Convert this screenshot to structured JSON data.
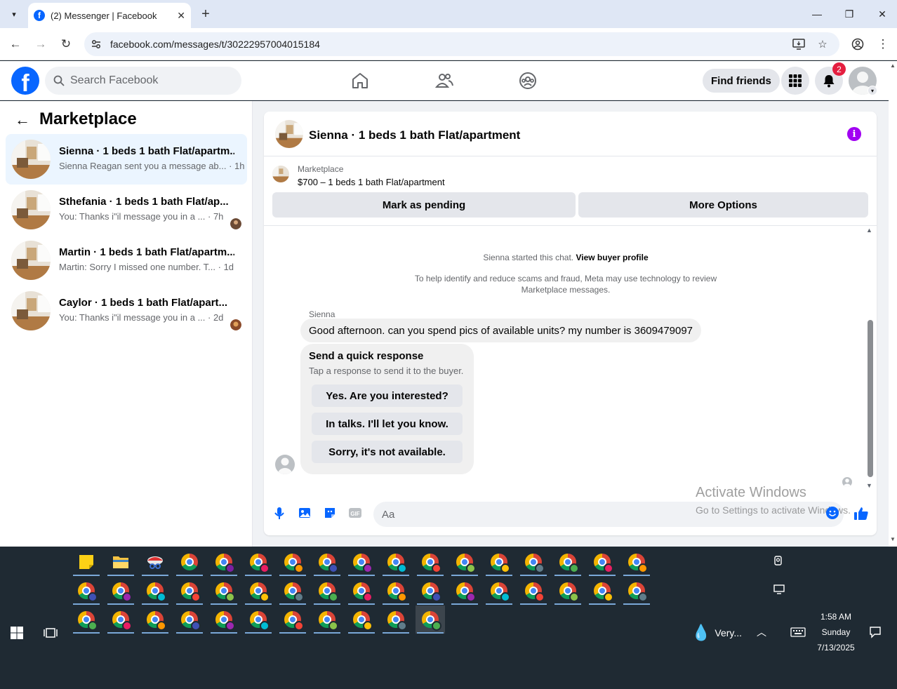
{
  "browser": {
    "tab_title": "(2) Messenger | Facebook",
    "url": "facebook.com/messages/t/30222957004015184"
  },
  "fb": {
    "search_placeholder": "Search Facebook",
    "find_friends": "Find friends",
    "notif_count": "2"
  },
  "left": {
    "title": "Marketplace",
    "conversations": [
      {
        "title": "Sienna · 1 beds 1 bath Flat/apartm...",
        "preview": "Sienna Reagan sent you a message ab... · 1h",
        "active": true
      },
      {
        "title": "Sthefania · 1 beds 1 bath Flat/ap...",
        "preview": "You: Thanks i\"il message you in a ...  · 7h",
        "active": false
      },
      {
        "title": "Martin · 1 beds 1 bath Flat/apartm...",
        "preview": "Martin: Sorry I missed one number. T...  · 1d",
        "active": false
      },
      {
        "title": "Caylor · 1 beds 1 bath Flat/apart...",
        "preview": "You: Thanks i\"il message you in a ...  · 2d",
        "active": false
      }
    ]
  },
  "chat": {
    "header_title": "Sienna · 1 beds 1 bath Flat/apartment",
    "listing_label": "Marketplace",
    "listing_price": "$700 – 1 beds 1 bath Flat/apartment",
    "mark_pending": "Mark as pending",
    "more_options": "More Options",
    "started_text": "Sienna started this chat.",
    "view_profile": "View buyer profile",
    "scam_notice": "To help identify and reduce scams and fraud, Meta may use technology to review Marketplace messages.",
    "sender_name": "Sienna",
    "message": "Good afternoon. can you spend pics of available units? my number is 3609479097",
    "quick_title": "Send a quick response",
    "quick_sub": "Tap a response to send it to the buyer.",
    "quick_responses": [
      "Yes. Are you interested?",
      "In talks. I'll let you know.",
      "Sorry, it's not available."
    ],
    "composer_placeholder": "Aa"
  },
  "watermark": {
    "line1": "Activate Windows",
    "line2": "Go to Settings to activate Windows."
  },
  "taskbar": {
    "weather": "Very...",
    "time": "1:58 AM",
    "day": "Sunday",
    "date": "7/13/2025"
  }
}
